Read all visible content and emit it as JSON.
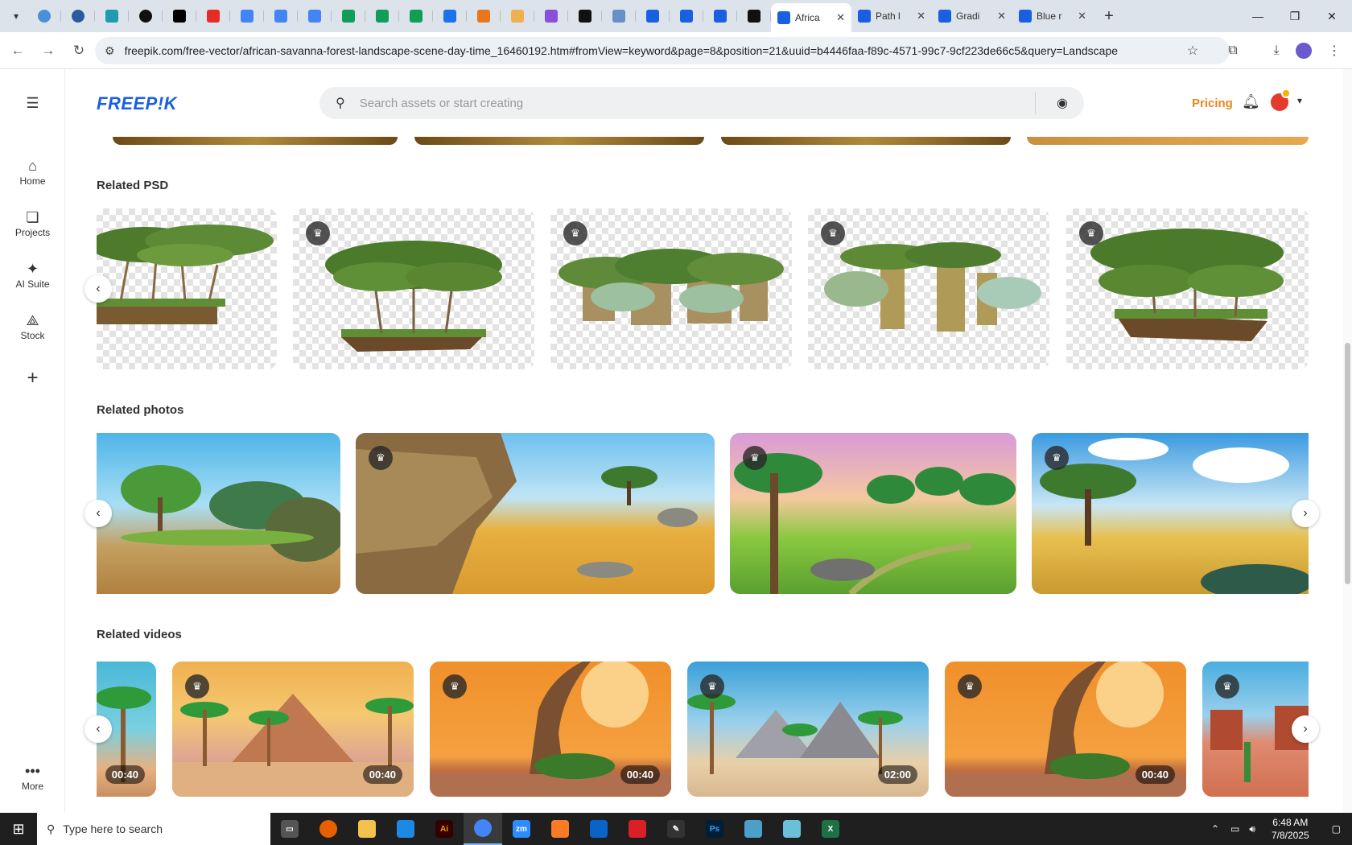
{
  "browser": {
    "active_tab": {
      "title": "Africa"
    },
    "other_tabs": [
      {
        "title": "Path l"
      },
      {
        "title": "Gradi"
      },
      {
        "title": "Blue r"
      }
    ],
    "url": "freepik.com/free-vector/african-savanna-forest-landscape-scene-day-time_16460192.htm#fromView=keyword&page=8&position=21&uuid=b4446faa-f89c-4571-99c7-9cf223de66c5&query=Landscape"
  },
  "header": {
    "logo": "FREEP!K",
    "search_placeholder": "Search assets or start creating",
    "pricing": "Pricing"
  },
  "sidebar": {
    "items": [
      {
        "label": "Home",
        "icon": "home-icon"
      },
      {
        "label": "Projects",
        "icon": "projects-icon"
      },
      {
        "label": "AI Suite",
        "icon": "ai-suite-icon"
      },
      {
        "label": "Stock",
        "icon": "stock-icon"
      }
    ],
    "more": "More"
  },
  "sections": {
    "psd": {
      "title": "Related PSD"
    },
    "photos": {
      "title": "Related photos"
    },
    "videos": {
      "title": "Related videos",
      "durations": [
        "00:40",
        "00:40",
        "00:40",
        "02:00",
        "00:40"
      ]
    }
  },
  "taskbar": {
    "search_placeholder": "Type here to search",
    "time": "6:48 AM",
    "date": "7/8/2025"
  },
  "colors": {
    "brand": "#1a5fe0",
    "pricing": "#e8861f"
  }
}
